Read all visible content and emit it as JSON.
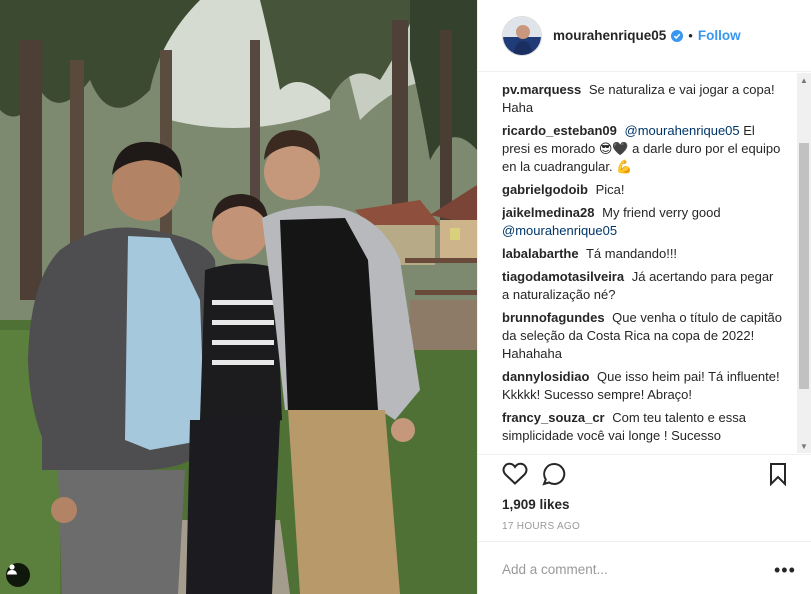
{
  "post": {
    "author": "mourahenrique05",
    "verified": true,
    "separator": "•",
    "follow_label": "Follow",
    "likes": "1,909 likes",
    "timestamp": "17 HOURS AGO",
    "comment_placeholder": "Add a comment...",
    "more_label": "•••"
  },
  "comments": [
    {
      "user": "pv.marquess",
      "text": "Se naturaliza e vai jogar a copa! Haha"
    },
    {
      "user": "ricardo_esteban09",
      "mention": "@mourahenrique05",
      "text": "El presi es morado 😎🖤 a darle duro por el equipo en la cuadrangular. 💪"
    },
    {
      "user": "gabrielgodoib",
      "text": "Pica!"
    },
    {
      "user": "jaikelmedina28",
      "text": "My friend verry good",
      "mention_after": "@mourahenrique05"
    },
    {
      "user": "labalabarthe",
      "text": "Tá mandando!!!"
    },
    {
      "user": "tiagodamotasilveira",
      "text": "Já acertando para pegar a naturalização né?"
    },
    {
      "user": "brunnofagundes",
      "text": "Que venha o título de capitão da seleção da Costa Rica na copa de 2022! Hahahaha"
    },
    {
      "user": "dannylosidiao",
      "text": "Que isso heim pai! Tá influente! Kkkkk! Sucesso sempre! Abraço!"
    },
    {
      "user": "francy_souza_cr",
      "text": "Com teu talento e essa simplicidade você vai longe ! Sucesso"
    }
  ],
  "icons": {
    "like": "heart-icon",
    "comment": "comment-icon",
    "save": "bookmark-icon",
    "tag": "user-tag-icon",
    "verified": "verified-badge-icon"
  },
  "colors": {
    "link": "#3897f0",
    "mention": "#003569",
    "text": "#262626",
    "muted": "#999999",
    "border": "#efefef"
  }
}
